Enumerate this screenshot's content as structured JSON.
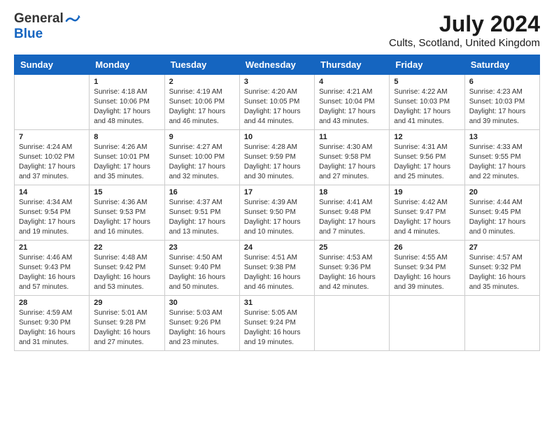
{
  "header": {
    "logo_general": "General",
    "logo_blue": "Blue",
    "month_title": "July 2024",
    "location": "Cults, Scotland, United Kingdom"
  },
  "days_of_week": [
    "Sunday",
    "Monday",
    "Tuesday",
    "Wednesday",
    "Thursday",
    "Friday",
    "Saturday"
  ],
  "weeks": [
    [
      {
        "date": "",
        "info": ""
      },
      {
        "date": "1",
        "info": "Sunrise: 4:18 AM\nSunset: 10:06 PM\nDaylight: 17 hours\nand 48 minutes."
      },
      {
        "date": "2",
        "info": "Sunrise: 4:19 AM\nSunset: 10:06 PM\nDaylight: 17 hours\nand 46 minutes."
      },
      {
        "date": "3",
        "info": "Sunrise: 4:20 AM\nSunset: 10:05 PM\nDaylight: 17 hours\nand 44 minutes."
      },
      {
        "date": "4",
        "info": "Sunrise: 4:21 AM\nSunset: 10:04 PM\nDaylight: 17 hours\nand 43 minutes."
      },
      {
        "date": "5",
        "info": "Sunrise: 4:22 AM\nSunset: 10:03 PM\nDaylight: 17 hours\nand 41 minutes."
      },
      {
        "date": "6",
        "info": "Sunrise: 4:23 AM\nSunset: 10:03 PM\nDaylight: 17 hours\nand 39 minutes."
      }
    ],
    [
      {
        "date": "7",
        "info": "Sunrise: 4:24 AM\nSunset: 10:02 PM\nDaylight: 17 hours\nand 37 minutes."
      },
      {
        "date": "8",
        "info": "Sunrise: 4:26 AM\nSunset: 10:01 PM\nDaylight: 17 hours\nand 35 minutes."
      },
      {
        "date": "9",
        "info": "Sunrise: 4:27 AM\nSunset: 10:00 PM\nDaylight: 17 hours\nand 32 minutes."
      },
      {
        "date": "10",
        "info": "Sunrise: 4:28 AM\nSunset: 9:59 PM\nDaylight: 17 hours\nand 30 minutes."
      },
      {
        "date": "11",
        "info": "Sunrise: 4:30 AM\nSunset: 9:58 PM\nDaylight: 17 hours\nand 27 minutes."
      },
      {
        "date": "12",
        "info": "Sunrise: 4:31 AM\nSunset: 9:56 PM\nDaylight: 17 hours\nand 25 minutes."
      },
      {
        "date": "13",
        "info": "Sunrise: 4:33 AM\nSunset: 9:55 PM\nDaylight: 17 hours\nand 22 minutes."
      }
    ],
    [
      {
        "date": "14",
        "info": "Sunrise: 4:34 AM\nSunset: 9:54 PM\nDaylight: 17 hours\nand 19 minutes."
      },
      {
        "date": "15",
        "info": "Sunrise: 4:36 AM\nSunset: 9:53 PM\nDaylight: 17 hours\nand 16 minutes."
      },
      {
        "date": "16",
        "info": "Sunrise: 4:37 AM\nSunset: 9:51 PM\nDaylight: 17 hours\nand 13 minutes."
      },
      {
        "date": "17",
        "info": "Sunrise: 4:39 AM\nSunset: 9:50 PM\nDaylight: 17 hours\nand 10 minutes."
      },
      {
        "date": "18",
        "info": "Sunrise: 4:41 AM\nSunset: 9:48 PM\nDaylight: 17 hours\nand 7 minutes."
      },
      {
        "date": "19",
        "info": "Sunrise: 4:42 AM\nSunset: 9:47 PM\nDaylight: 17 hours\nand 4 minutes."
      },
      {
        "date": "20",
        "info": "Sunrise: 4:44 AM\nSunset: 9:45 PM\nDaylight: 17 hours\nand 0 minutes."
      }
    ],
    [
      {
        "date": "21",
        "info": "Sunrise: 4:46 AM\nSunset: 9:43 PM\nDaylight: 16 hours\nand 57 minutes."
      },
      {
        "date": "22",
        "info": "Sunrise: 4:48 AM\nSunset: 9:42 PM\nDaylight: 16 hours\nand 53 minutes."
      },
      {
        "date": "23",
        "info": "Sunrise: 4:50 AM\nSunset: 9:40 PM\nDaylight: 16 hours\nand 50 minutes."
      },
      {
        "date": "24",
        "info": "Sunrise: 4:51 AM\nSunset: 9:38 PM\nDaylight: 16 hours\nand 46 minutes."
      },
      {
        "date": "25",
        "info": "Sunrise: 4:53 AM\nSunset: 9:36 PM\nDaylight: 16 hours\nand 42 minutes."
      },
      {
        "date": "26",
        "info": "Sunrise: 4:55 AM\nSunset: 9:34 PM\nDaylight: 16 hours\nand 39 minutes."
      },
      {
        "date": "27",
        "info": "Sunrise: 4:57 AM\nSunset: 9:32 PM\nDaylight: 16 hours\nand 35 minutes."
      }
    ],
    [
      {
        "date": "28",
        "info": "Sunrise: 4:59 AM\nSunset: 9:30 PM\nDaylight: 16 hours\nand 31 minutes."
      },
      {
        "date": "29",
        "info": "Sunrise: 5:01 AM\nSunset: 9:28 PM\nDaylight: 16 hours\nand 27 minutes."
      },
      {
        "date": "30",
        "info": "Sunrise: 5:03 AM\nSunset: 9:26 PM\nDaylight: 16 hours\nand 23 minutes."
      },
      {
        "date": "31",
        "info": "Sunrise: 5:05 AM\nSunset: 9:24 PM\nDaylight: 16 hours\nand 19 minutes."
      },
      {
        "date": "",
        "info": ""
      },
      {
        "date": "",
        "info": ""
      },
      {
        "date": "",
        "info": ""
      }
    ]
  ]
}
